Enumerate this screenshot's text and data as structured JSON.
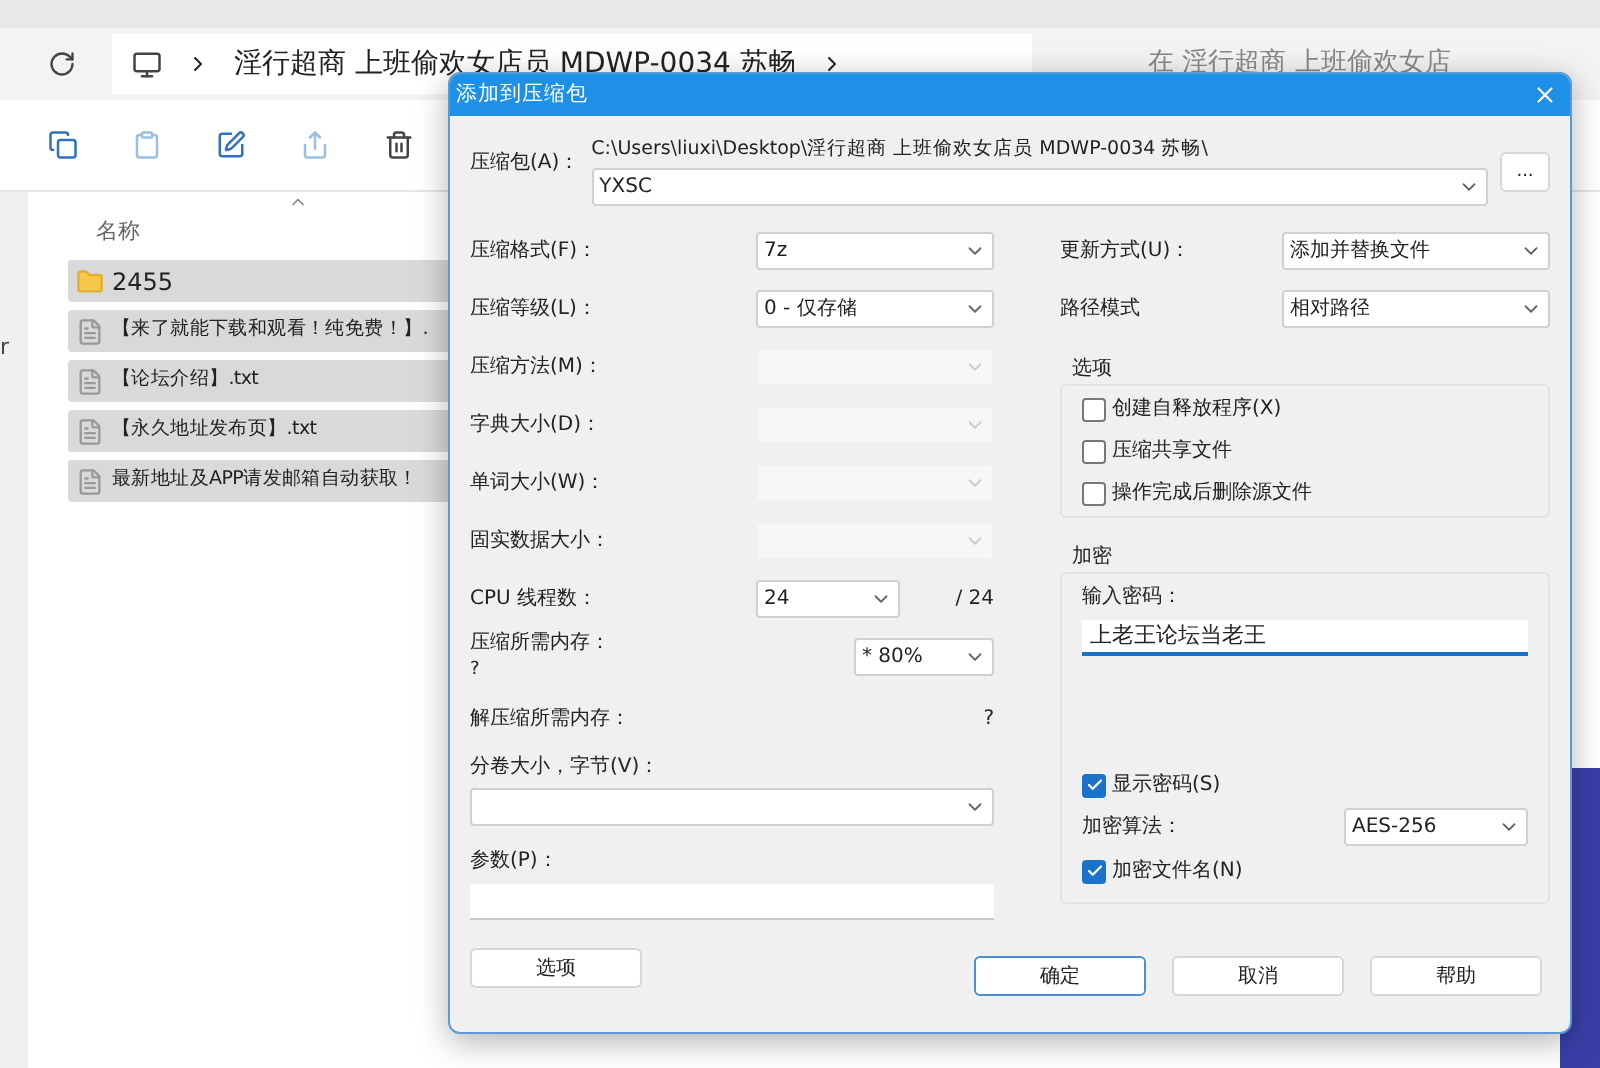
{
  "explorer": {
    "address": "淫行超商 上班偷欢女店员 MDWP-0034 苏畅",
    "search_placeholder": "在 淫行超商 上班偷欢女店",
    "sidebar_fragment": "r",
    "column_header": "名称",
    "files": [
      {
        "name": "2455",
        "kind": "folder",
        "selected": true
      },
      {
        "name": "【来了就能下载和观看！纯免费！】.",
        "kind": "file",
        "selected": true
      },
      {
        "name": "【论坛介绍】.txt",
        "kind": "file",
        "selected": true
      },
      {
        "name": "【永久地址发布页】.txt",
        "kind": "file",
        "selected": true
      },
      {
        "name": "最新地址及APP请发邮箱自动获取！",
        "kind": "file",
        "selected": true
      }
    ]
  },
  "dialog": {
    "title": "添加到压缩包",
    "archive_label": "压缩包(A)：",
    "archive_path": "C:\\Users\\liuxi\\Desktop\\淫行超商 上班偷欢女店员 MDWP-0034 苏畅\\",
    "archive_name": "YXSC",
    "browse_button": "...",
    "left_fields": [
      {
        "label": "压缩格式(F)：",
        "value": "7z",
        "disabled": false
      },
      {
        "label": "压缩等级(L)：",
        "value": "0 - 仅存储",
        "disabled": false
      },
      {
        "label": "压缩方法(M)：",
        "disabled": true
      },
      {
        "label": "字典大小(D)：",
        "disabled": true
      },
      {
        "label": "单词大小(W)：",
        "disabled": true
      },
      {
        "label": "固实数据大小：",
        "disabled": true
      }
    ],
    "cpu": {
      "label": "CPU 线程数：",
      "value": "24",
      "max": "/ 24"
    },
    "memory": {
      "label": "压缩所需内存：",
      "note": "?",
      "value": "* 80%"
    },
    "decompress": {
      "label": "解压缩所需内存：",
      "value": "?"
    },
    "volume_label": "分卷大小，字节(V)：",
    "params_label": "参数(P)：",
    "options_button": "选项",
    "update_mode": {
      "label": "更新方式(U)：",
      "value": "添加并替换文件"
    },
    "path_mode": {
      "label": "路径模式",
      "value": "相对路径"
    },
    "options": {
      "title": "选项",
      "checkboxes": [
        {
          "label": "创建自释放程序(X)",
          "checked": false
        },
        {
          "label": "压缩共享文件",
          "checked": false
        },
        {
          "label": "操作完成后删除源文件",
          "checked": false
        }
      ]
    },
    "encryption": {
      "title": "加密",
      "password_label": "输入密码：",
      "password": "上老王论坛当老王",
      "show_password": {
        "label": "显示密码(S)",
        "checked": true
      },
      "method_label": "加密算法：",
      "method": "AES-256",
      "encrypt_names": {
        "label": "加密文件名(N)",
        "checked": true
      }
    },
    "buttons": [
      {
        "label": "确定",
        "default": true
      },
      {
        "label": "取消",
        "default": false
      },
      {
        "label": "帮助",
        "default": false
      }
    ]
  }
}
